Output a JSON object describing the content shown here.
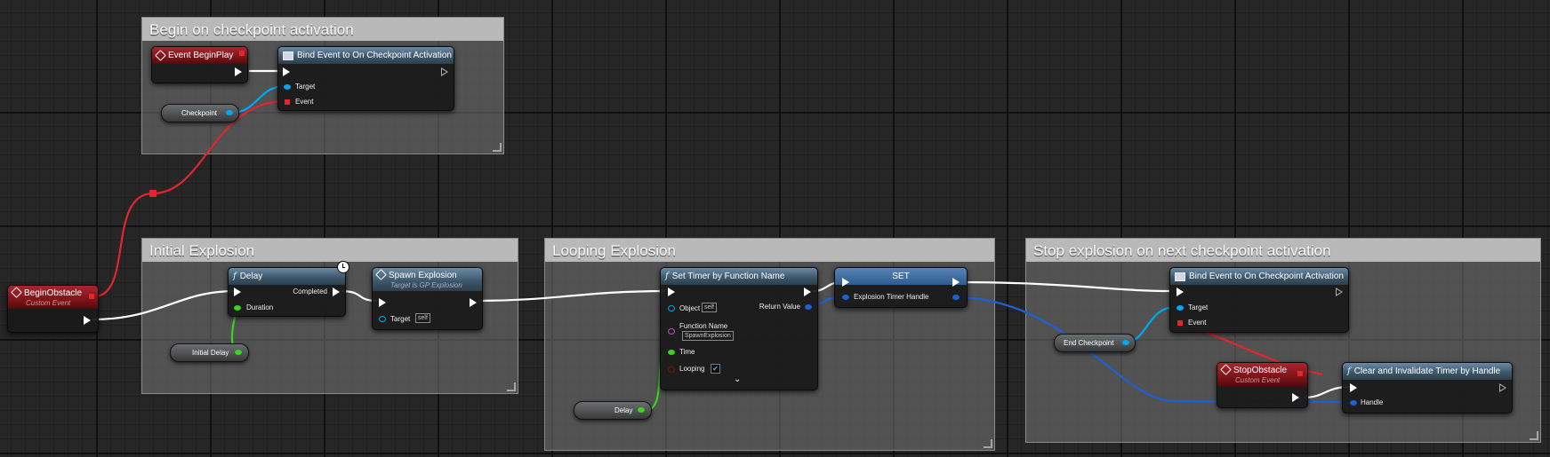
{
  "comments": {
    "begin_checkpoint": "Begin on checkpoint activation",
    "initial_explosion": "Initial Explosion",
    "looping_explosion": "Looping Explosion",
    "stop_explosion": "Stop explosion on next checkpoint activation"
  },
  "event_beginplay": {
    "title": "Event BeginPlay"
  },
  "bind_event_1": {
    "title": "Bind Event to On Checkpoint Activation",
    "target": "Target",
    "event": "Event"
  },
  "checkpoint_var": {
    "label": "Checkpoint"
  },
  "begin_obstacle": {
    "title": "BeginObstacle",
    "subtitle": "Custom Event"
  },
  "delay_node": {
    "title": "Delay",
    "completed": "Completed",
    "duration": "Duration"
  },
  "initial_delay_var": {
    "label": "Initial Delay"
  },
  "spawn_explosion": {
    "title": "Spawn Explosion",
    "subtitle": "Target is GP Explosion",
    "target": "Target",
    "self": "self"
  },
  "set_timer": {
    "title": "Set Timer by Function Name",
    "object": "Object",
    "self": "self",
    "return_value": "Return Value",
    "function_name": "Function Name",
    "function_value": "SpawnExplosion",
    "time": "Time",
    "looping": "Looping",
    "expand": "⌄"
  },
  "delay_var": {
    "label": "Delay"
  },
  "set_node": {
    "title": "SET",
    "var": "Explosion Timer Handle"
  },
  "bind_event_2": {
    "title": "Bind Event to On Checkpoint Activation",
    "target": "Target",
    "event": "Event"
  },
  "end_checkpoint_var": {
    "label": "End Checkpoint"
  },
  "stop_obstacle": {
    "title": "StopObstacle",
    "subtitle": "Custom Event"
  },
  "clear_timer": {
    "title": "Clear and Invalidate Timer by Handle",
    "handle": "Handle"
  },
  "colors": {
    "exec": "#ffffff",
    "object": "#00a8f4",
    "delegate": "#e0262e",
    "float": "#39d51c",
    "name": "#c94cc9",
    "struct": "#1e5fd6"
  }
}
